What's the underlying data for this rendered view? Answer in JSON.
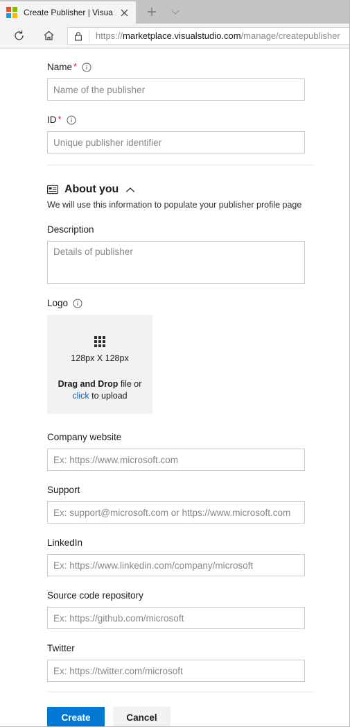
{
  "browser": {
    "tab": {
      "title": "Create Publisher | Visua",
      "favicon_name": "microsoft-logo-icon",
      "close_label": "×"
    },
    "new_tab_label": "+",
    "tab_list_label": "⌄",
    "toolbar": {
      "reload_label": "Reload",
      "home_label": "Home"
    },
    "address": {
      "lock_icon": "lock-icon",
      "url_scheme": "https://",
      "url_host": "marketplace.visualstudio.com",
      "url_path": "/manage/createpublisher"
    }
  },
  "form": {
    "name": {
      "label": "Name",
      "required_marker": "*",
      "placeholder": "Name of the publisher",
      "value": ""
    },
    "id": {
      "label": "ID",
      "required_marker": "*",
      "placeholder": "Unique publisher identifier",
      "value": ""
    },
    "about": {
      "icon": "contact-card-icon",
      "title": "About you",
      "chevron": "chevron-up-icon",
      "subtitle": "We will use this information to populate your publisher profile page"
    },
    "description": {
      "label": "Description",
      "placeholder": "Details of publisher",
      "value": ""
    },
    "logo": {
      "label": "Logo",
      "grid_icon": "grid-icon",
      "dimensions": "128px X 128px",
      "dnd_bold": "Drag and Drop",
      "dnd_rest": " file or",
      "upload_link": "click",
      "upload_rest": " to upload"
    },
    "company_website": {
      "label": "Company website",
      "placeholder": "Ex: https://www.microsoft.com",
      "value": ""
    },
    "support": {
      "label": "Support",
      "placeholder": "Ex: support@microsoft.com or https://www.microsoft.com",
      "value": ""
    },
    "linkedin": {
      "label": "LinkedIn",
      "placeholder": "Ex: https://www.linkedin.com/company/microsoft",
      "value": ""
    },
    "source_repo": {
      "label": "Source code repository",
      "placeholder": "Ex: https://github.com/microsoft",
      "value": ""
    },
    "twitter": {
      "label": "Twitter",
      "placeholder": "Ex: https://twitter.com/microsoft",
      "value": ""
    }
  },
  "actions": {
    "create_label": "Create",
    "cancel_label": "Cancel"
  },
  "colors": {
    "accent": "#0078d4",
    "required": "#e81123",
    "link": "#0066cc",
    "dropzone_bg": "#f2f2f2",
    "cancel_bg": "#f3f2f1"
  }
}
